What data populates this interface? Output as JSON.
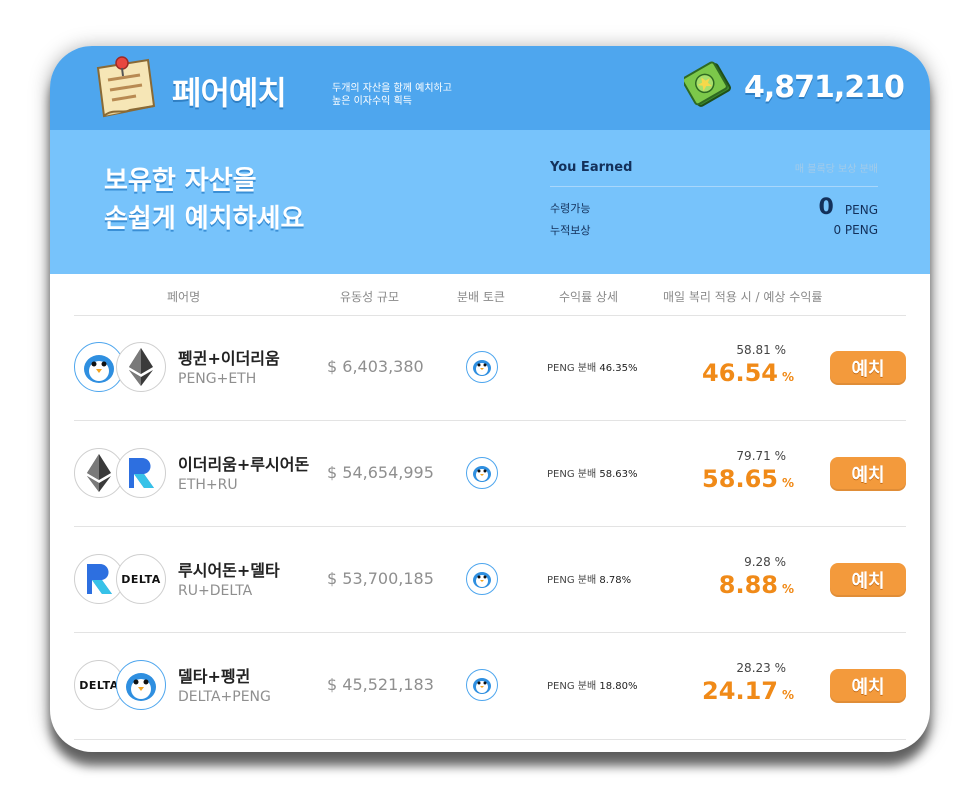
{
  "header": {
    "title": "페어예치",
    "subtitle_line1": "두개의 자산을 함께 예치하고",
    "subtitle_line2": "높은 이자수익 획득",
    "total": "4,871,210",
    "memo_icon": "memo-note-icon",
    "cash_icon": "cash-icon"
  },
  "banner": {
    "line1": "보유한 자산을",
    "line2": "손쉽게 예치하세요",
    "earned": {
      "title": "You Earned",
      "note": "매 블록당 보상 분배",
      "claimable_label": "수령가능",
      "claimable_value": "0",
      "claimable_unit": "PENG",
      "cumulative_label": "누적보상",
      "cumulative_value": "0 PENG"
    }
  },
  "table": {
    "headers": [
      "페어명",
      "유동성 규모",
      "분배 토큰",
      "수익률 상세",
      "매일 복리 적용 시 / 예상 수익률"
    ],
    "button_label": "예치",
    "pct_symbol": "%",
    "rows": [
      {
        "name": "펭귄+이더리움",
        "symbol": "PENG+ETH",
        "liquidity": "$ 6,403,380",
        "dist_label": "PENG 분배",
        "dist_pct": "46.35%",
        "daily": "58.81 %",
        "apy": "46.54",
        "coin1": "penguin",
        "coin2": "eth"
      },
      {
        "name": "이더리움+루시어돈",
        "symbol": "ETH+RU",
        "liquidity": "$ 54,654,995",
        "dist_label": "PENG 분배",
        "dist_pct": "58.63%",
        "daily": "79.71 %",
        "apy": "58.65",
        "coin1": "eth",
        "coin2": "ru"
      },
      {
        "name": "루시어돈+델타",
        "symbol": "RU+DELTA",
        "liquidity": "$ 53,700,185",
        "dist_label": "PENG 분배",
        "dist_pct": "8.78%",
        "daily": "9.28 %",
        "apy": "8.88",
        "coin1": "ru",
        "coin2": "delta"
      },
      {
        "name": "델타+펭귄",
        "symbol": "DELTA+PENG",
        "liquidity": "$ 45,521,183",
        "dist_label": "PENG 분배",
        "dist_pct": "18.80%",
        "daily": "28.23 %",
        "apy": "24.17",
        "coin1": "delta",
        "coin2": "penguin"
      }
    ]
  },
  "colors": {
    "header": "#4ea6ee",
    "banner": "#77c3fb",
    "accent_orange": "#f08a18",
    "button": "#f39a3c"
  },
  "logo_text": {
    "delta": "DELTA"
  }
}
